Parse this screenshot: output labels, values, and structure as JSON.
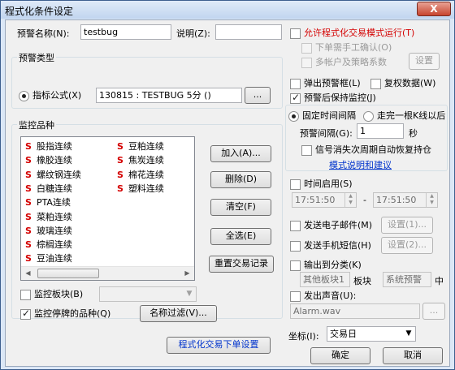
{
  "window": {
    "title": "程式化条件设定",
    "close_glyph": "X"
  },
  "header": {
    "name_label": "预警名称(N):",
    "name_value": "testbug",
    "desc_label": "说明(Z):",
    "desc_value": ""
  },
  "alert_type": {
    "group_label": "预警类型",
    "formula_label": "指标公式(X)",
    "formula_value": "130815 : TESTBUG 5分 ()",
    "browse_label": "..."
  },
  "monitor": {
    "group_label": "监控品种",
    "items_col1": [
      {
        "mark": "S",
        "label": "股指连续"
      },
      {
        "mark": "S",
        "label": "橡胶连续"
      },
      {
        "mark": "S",
        "label": "螺纹钢连续"
      },
      {
        "mark": "S",
        "label": "白糖连续"
      },
      {
        "mark": "S",
        "label": "PTA连续"
      },
      {
        "mark": "S",
        "label": "菜粕连续"
      },
      {
        "mark": "S",
        "label": "玻璃连续"
      },
      {
        "mark": "S",
        "label": "棕榈连续"
      },
      {
        "mark": "S",
        "label": "豆油连续"
      }
    ],
    "items_col2": [
      {
        "mark": "S",
        "label": "豆粕连续"
      },
      {
        "mark": "S",
        "label": "焦炭连续"
      },
      {
        "mark": "S",
        "label": "棉花连续"
      },
      {
        "mark": "S",
        "label": "塑料连续"
      }
    ],
    "scroll_left": "◀",
    "scroll_right": "▶",
    "add_button": "加入(A)...",
    "delete_button": "删除(D)",
    "clear_button": "清空(F)",
    "select_all_button": "全选(E)",
    "reset_trade_button": "重置交易记录",
    "board_label": "监控板块(B)",
    "board_value": "",
    "suspended_label": "监控停牌的品种(Q)",
    "name_filter_button": "名称过滤(V)..."
  },
  "right": {
    "allow_trade_label": "允许程式化交易模式运行(T)",
    "manual_confirm_label": "下单需手工确认(O)",
    "multi_account_label": "多帐户及策略系数",
    "settings_button": "设置",
    "popup_label": "弹出预警框(L)",
    "review_label": "复权数据(W)",
    "keep_monitor_label": "预警后保持监控(J)",
    "fixed_interval_label": "固定时间间隔",
    "per_kline_label": "走完一根K线以后",
    "interval_label": "预警间隔(G):",
    "interval_value": "1",
    "interval_unit": "秒",
    "auto_restore_label": "信号消失次周期自动恢复持仓",
    "help_link": "模式说明和建议",
    "time_enable_label": "时间启用(S)",
    "time_start": "17:51:50",
    "time_dash": "-",
    "time_end": "17:51:50",
    "email_label": "发送电子邮件(M)",
    "email_settings": "设置(1)...",
    "sms_label": "发送手机短信(H)",
    "sms_settings": "设置(2)...",
    "export_label": "输出到分类(K)",
    "export_board": "其他板块1",
    "export_board_suffix": "板块",
    "export_system": "系统预警",
    "export_mid": "中",
    "sound_label": "发出声音(U):",
    "sound_file": "Alarm.wav",
    "sound_browse": "...",
    "coord_label": "坐标(I):",
    "coord_value": "交易日",
    "ok_button": "确定",
    "cancel_button": "取消"
  },
  "footer": {
    "program_order_button": "程式化交易下单设置"
  },
  "icons": {
    "combo_arrow": "▼",
    "spin_up": "▲",
    "spin_down": "▼"
  },
  "colors": {
    "accent_red": "#d40000",
    "link_blue": "#0033cc",
    "title_bar": "#c1d5ef",
    "close_red": "#c7432e"
  }
}
